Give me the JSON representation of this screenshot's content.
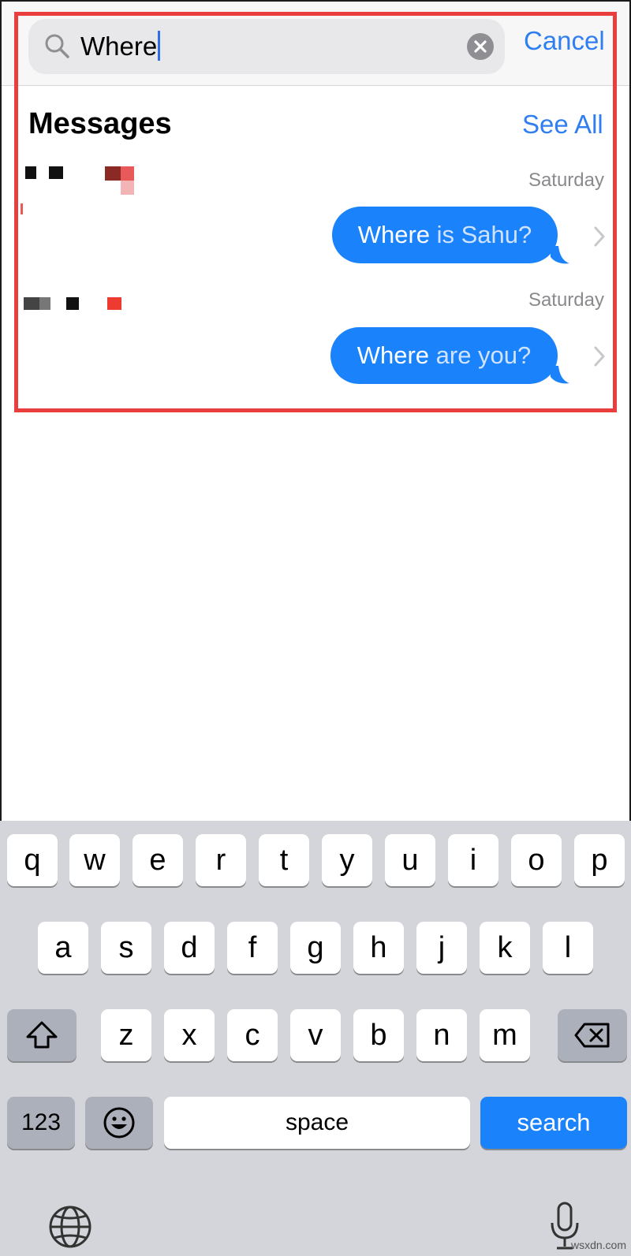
{
  "search": {
    "query": "Where",
    "cancel_label": "Cancel"
  },
  "messages_section": {
    "title": "Messages",
    "see_all_label": "See All",
    "results": [
      {
        "date": "Saturday",
        "text_match": "Where",
        "text_rest": " is Sahu?"
      },
      {
        "date": "Saturday",
        "text_match": "Where",
        "text_rest": " are you?"
      }
    ]
  },
  "keyboard": {
    "row1": [
      "q",
      "w",
      "e",
      "r",
      "t",
      "y",
      "u",
      "i",
      "o",
      "p"
    ],
    "row2": [
      "a",
      "s",
      "d",
      "f",
      "g",
      "h",
      "j",
      "k",
      "l"
    ],
    "row3": [
      "z",
      "x",
      "c",
      "v",
      "b",
      "n",
      "m"
    ],
    "numbers_label": "123",
    "space_label": "space",
    "search_label": "search"
  },
  "watermark": "wsxdn.com",
  "colors": {
    "accent": "#2f7ff0",
    "bubble": "#1a82fb",
    "highlight": "#e83e3e",
    "keyboard_bg": "#d3d5da"
  }
}
